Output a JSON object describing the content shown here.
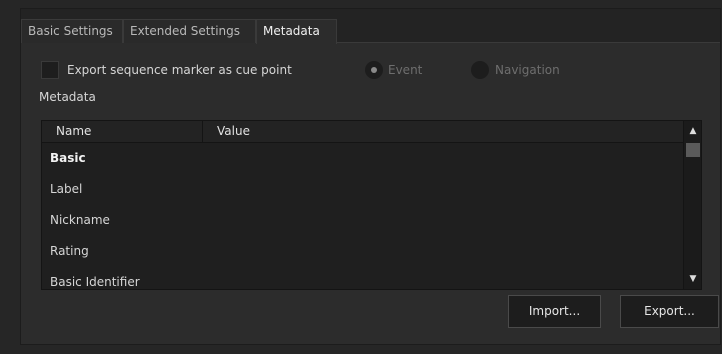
{
  "tabs": [
    {
      "label": "Basic Settings",
      "active": false
    },
    {
      "label": "Extended Settings",
      "active": false
    },
    {
      "label": "Metadata",
      "active": true
    }
  ],
  "export_marker": {
    "label": "Export sequence marker as cue point",
    "checked": false
  },
  "cue_type": {
    "options": [
      {
        "label": "Event",
        "selected": true,
        "enabled": false
      },
      {
        "label": "Navigation",
        "selected": false,
        "enabled": false
      }
    ]
  },
  "metadata": {
    "section_label": "Metadata",
    "columns": [
      "Name",
      "Value"
    ],
    "rows": [
      {
        "name": "Basic",
        "value": "",
        "bold": true
      },
      {
        "name": "Label",
        "value": ""
      },
      {
        "name": "Nickname",
        "value": ""
      },
      {
        "name": "Rating",
        "value": ""
      },
      {
        "name": "Basic Identifier",
        "value": ""
      }
    ]
  },
  "buttons": {
    "import": "Import...",
    "export": "Export..."
  },
  "icons": {
    "scroll_up": "triangle-up-icon",
    "scroll_down": "triangle-down-icon"
  }
}
